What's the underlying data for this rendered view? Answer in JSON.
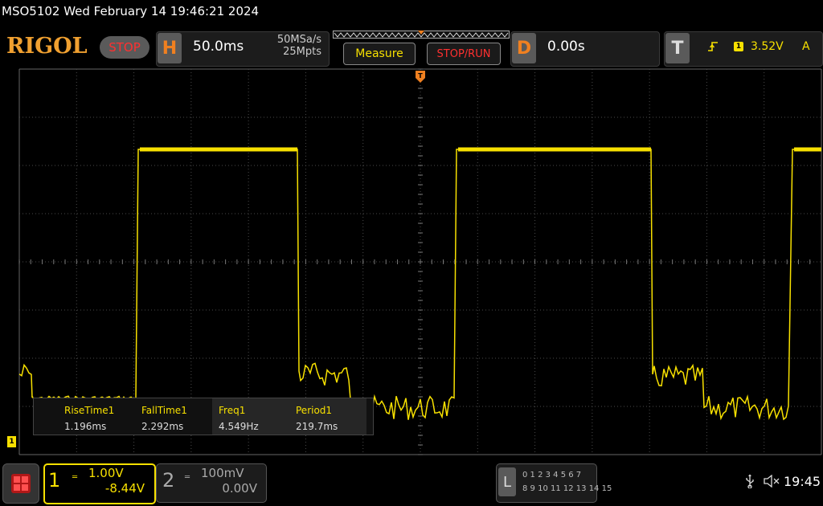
{
  "title": "MSO5102  Wed February 14 19:46:21 2024",
  "brand": "RIGOL",
  "run_state": "STOP",
  "horizontal": {
    "label": "H",
    "timebase": "50.0ms",
    "sample_rate": "50MSa/s",
    "memory_depth": "25Mpts"
  },
  "buttons": {
    "measure": "Measure",
    "stop_run": "STOP/RUN"
  },
  "delay": {
    "label": "D",
    "value": "0.00s"
  },
  "trigger": {
    "label": "T",
    "source": "1",
    "level": "3.52V",
    "mode": "A"
  },
  "measurements": [
    {
      "name": "RiseTime1",
      "value": "1.196ms"
    },
    {
      "name": "FallTime1",
      "value": "2.292ms"
    },
    {
      "name": "Freq1",
      "value": "4.549Hz"
    },
    {
      "name": "Period1",
      "value": "219.7ms"
    }
  ],
  "channel1": {
    "number": "1",
    "scale": "1.00V",
    "offset": "-8.44V",
    "ground_marker": "1"
  },
  "channel2": {
    "number": "2",
    "scale": "100mV",
    "offset": "0.00V"
  },
  "logic": {
    "label": "L",
    "row1": "0 1 2 3  4 5 6 7",
    "row2": "8 9 10 11 12 13 14 15"
  },
  "status": {
    "time": "19:45"
  },
  "colors": {
    "ch1": "#f7e000",
    "accent": "#f08020",
    "stop": "#ff3030",
    "grid": "#555555"
  },
  "icons": {
    "usb": "usb-icon",
    "speaker": "speaker-muted-icon",
    "menu": "menu-grid-icon",
    "trigger_edge": "rising-edge-icon"
  }
}
